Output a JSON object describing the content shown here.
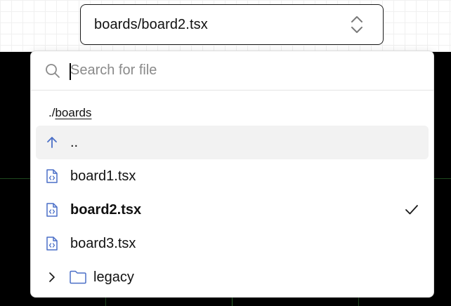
{
  "file_select": {
    "value": "boards/board2.tsx"
  },
  "dropdown": {
    "search": {
      "placeholder": "Search for file",
      "value": ""
    },
    "path": {
      "prefix": "./",
      "dir": "boards"
    },
    "items": [
      {
        "label": "..",
        "icon": "arrow-up-icon",
        "type": "parent"
      },
      {
        "label": "board1.tsx",
        "icon": "file-code-icon",
        "type": "file"
      },
      {
        "label": "board2.tsx",
        "icon": "file-code-icon",
        "type": "file",
        "selected": true
      },
      {
        "label": "board3.tsx",
        "icon": "file-code-icon",
        "type": "file"
      },
      {
        "label": "legacy",
        "icon": "folder-icon",
        "type": "folder"
      }
    ]
  },
  "colors": {
    "accent_blue": "#4a6fc7",
    "highlight_bg": "#f2f2f2",
    "canvas_bg": "#000000"
  }
}
